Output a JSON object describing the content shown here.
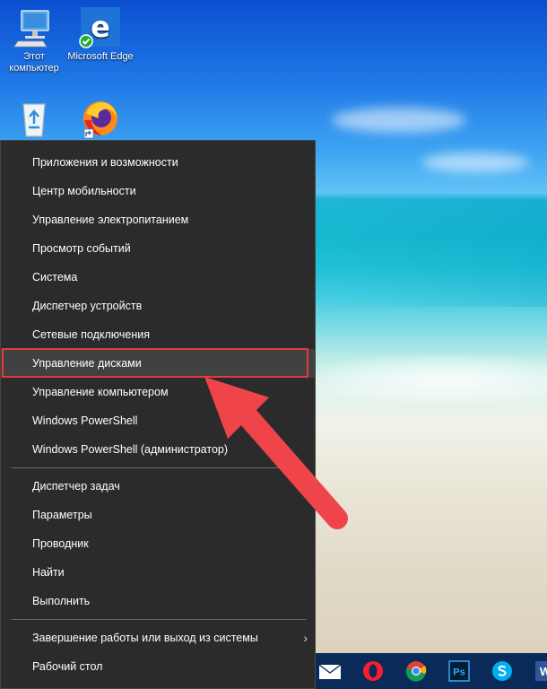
{
  "desktop": {
    "icons": [
      {
        "name": "this-pc",
        "label": "Этот компьютер"
      },
      {
        "name": "microsoft-edge",
        "label": "Microsoft Edge"
      },
      {
        "name": "recycle-bin",
        "label": ""
      },
      {
        "name": "firefox",
        "label": ""
      }
    ]
  },
  "menu": {
    "groups": [
      {
        "items": [
          {
            "id": "apps-features",
            "label": "Приложения и возможности"
          },
          {
            "id": "mobility-center",
            "label": "Центр мобильности"
          },
          {
            "id": "power-options",
            "label": "Управление электропитанием"
          },
          {
            "id": "event-viewer",
            "label": "Просмотр событий"
          },
          {
            "id": "system",
            "label": "Система"
          },
          {
            "id": "device-manager",
            "label": "Диспетчер устройств"
          },
          {
            "id": "network-connections",
            "label": "Сетевые подключения"
          },
          {
            "id": "disk-management",
            "label": "Управление дисками"
          },
          {
            "id": "computer-management",
            "label": "Управление компьютером"
          },
          {
            "id": "powershell",
            "label": "Windows PowerShell"
          },
          {
            "id": "powershell-admin",
            "label": "Windows PowerShell (администратор)"
          }
        ]
      },
      {
        "items": [
          {
            "id": "task-manager",
            "label": "Диспетчер задач"
          },
          {
            "id": "settings",
            "label": "Параметры"
          },
          {
            "id": "explorer",
            "label": "Проводник"
          },
          {
            "id": "search",
            "label": "Найти"
          },
          {
            "id": "run",
            "label": "Выполнить"
          }
        ]
      },
      {
        "items": [
          {
            "id": "shutdown-signout",
            "label": "Завершение работы или выход из системы",
            "submenu_glyph": "›"
          },
          {
            "id": "desktop",
            "label": "Рабочий стол"
          }
        ]
      }
    ],
    "selected_item": "disk-management"
  },
  "taskbar": {
    "icons": [
      "mail-icon",
      "opera-icon",
      "chrome-icon",
      "photoshop-icon",
      "skype-icon",
      "word-icon"
    ],
    "photoshop_text": "Ps",
    "word_text": "W"
  },
  "colors": {
    "menu_bg": "#2b2b2b",
    "menu_selected": "#414141",
    "highlight_red": "#e23b3b",
    "arrow_red": "#ef4449",
    "taskbar": "#0a2a59"
  }
}
